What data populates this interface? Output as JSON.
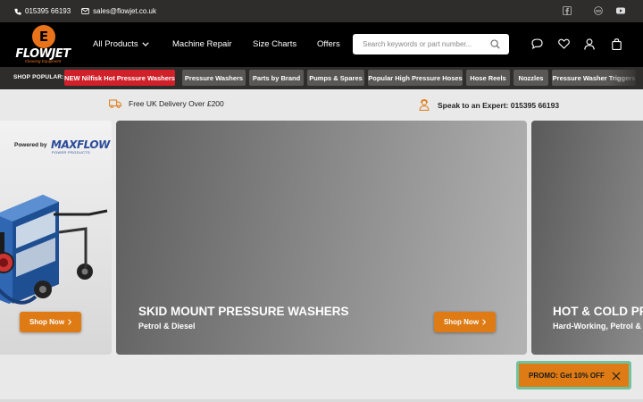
{
  "topbar": {
    "phone": "015395 66193",
    "email": "sales@flowjet.co.uk",
    "social": [
      "facebook-icon",
      "tripadvisor-icon",
      "youtube-icon"
    ]
  },
  "logo": {
    "mark": "E",
    "word": "FLOWJET",
    "tagline": "Cleaning Equipment"
  },
  "nav": {
    "items": [
      {
        "label": "All Products",
        "dropdown": true
      },
      {
        "label": "Machine Repair"
      },
      {
        "label": "Size Charts"
      },
      {
        "label": "Offers"
      }
    ]
  },
  "search": {
    "placeholder": "Search keywords or part number..."
  },
  "header_icons": [
    "chat-icon",
    "heart-icon",
    "user-icon",
    "bag-icon"
  ],
  "popular": {
    "label": "SHOP POPULAR:",
    "chips": [
      {
        "label": "NEW Nilfisk Hot Pressure Washers",
        "highlight": true
      },
      {
        "label": "Pressure Washers"
      },
      {
        "label": "Parts by Brand"
      },
      {
        "label": "Pumps & Spares"
      },
      {
        "label": "Popular High Pressure Hoses"
      },
      {
        "label": "Hose Reels"
      },
      {
        "label": "Nozzles"
      },
      {
        "label": "Pressure Washer Triggers"
      }
    ]
  },
  "info": {
    "delivery": "Free UK Delivery Over £200",
    "expert": "Speak to an Expert: 015395 66193"
  },
  "banners": [
    {
      "powered_by": "Powered by",
      "brand": "MAXFLOW",
      "brand_sub": "POWER PRODUCTS",
      "cta": "Shop Now"
    },
    {
      "title": "SKID MOUNT PRESSURE WASHERS",
      "subtitle": "Petrol & Diesel",
      "cta": "Shop Now"
    },
    {
      "title": "HOT & COLD PR",
      "subtitle": "Hard-Working, Petrol & I"
    }
  ],
  "promo": {
    "label": "PROMO: Get 10% OFF"
  },
  "colors": {
    "accent": "#df7b14",
    "highlight_chip": "#d0202a",
    "dark": "#2f2d2c",
    "promo_border": "#6fc3a0"
  }
}
